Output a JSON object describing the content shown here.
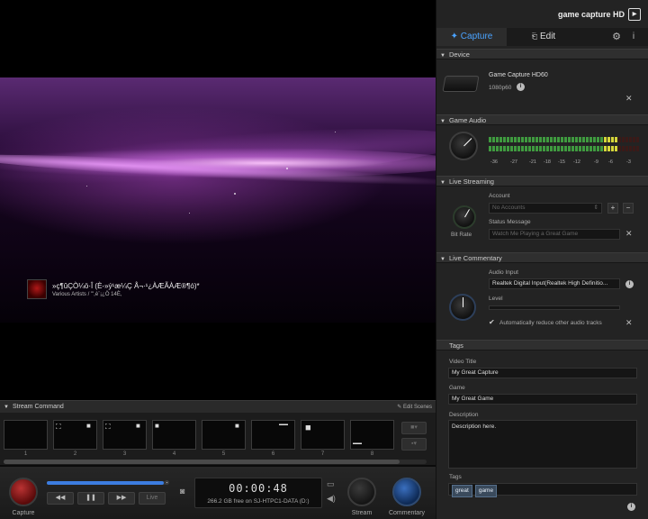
{
  "now_playing": {
    "title": "»ç¶ûÇÒ¼ö·Î (È-»ý¹æ¼Ç Å¬·¹¿ÀÆÃÀÆ®¶ó)*",
    "subtitle": "Various Artists / \"',è¨¡¿Ö 14È,"
  },
  "stream_command": {
    "header": "Stream Command",
    "edit_label": "Edit Scenes",
    "scene_numbers": [
      "1",
      "2",
      "3",
      "4",
      "5",
      "6",
      "7",
      "8"
    ]
  },
  "transport": {
    "live_label": "Live",
    "timecode": "00:00:48",
    "free_space": "266.2 GB free on SJ-HTPC1-DATA (D:)",
    "capture_label": "Capture",
    "stream_label": "Stream",
    "commentary_label": "Commentary",
    "progress": 0.97
  },
  "app": {
    "brand": "game capture HD"
  },
  "tabs": {
    "capture": "Capture",
    "edit": "Edit"
  },
  "device": {
    "header": "Device",
    "name": "Game Capture HD60",
    "resolution": "1080p60"
  },
  "game_audio": {
    "header": "Game Audio",
    "scale": [
      "-36",
      "-27",
      "-21",
      "-18",
      "-15",
      "-12",
      "-9",
      "-6",
      "-3"
    ],
    "level": 0.85
  },
  "live_streaming": {
    "header": "Live Streaming",
    "account_label": "Account",
    "account_value": "No Accounts",
    "status_label": "Status Message",
    "status_placeholder": "Watch Me Playing a Great Game",
    "knob_label": "Bit Rate"
  },
  "live_commentary": {
    "header": "Live Commentary",
    "audio_input_label": "Audio Input",
    "audio_input_value": "Realtek Digital Input(Realtek High Definitio...",
    "level_label": "Level",
    "auto_reduce_label": "Automatically reduce other audio tracks"
  },
  "tags_section": {
    "header": "Tags",
    "video_title_label": "Video Title",
    "video_title_value": "My Great Capture",
    "game_label": "Game",
    "game_value": "My Great Game",
    "description_label": "Description",
    "description_value": "Description here.",
    "tags_label": "Tags",
    "tags": [
      "great",
      "game"
    ]
  },
  "colors": {
    "accent": "#4aa3ff",
    "capture_red": "#b33333",
    "commentary_blue": "#3a6fbf"
  }
}
